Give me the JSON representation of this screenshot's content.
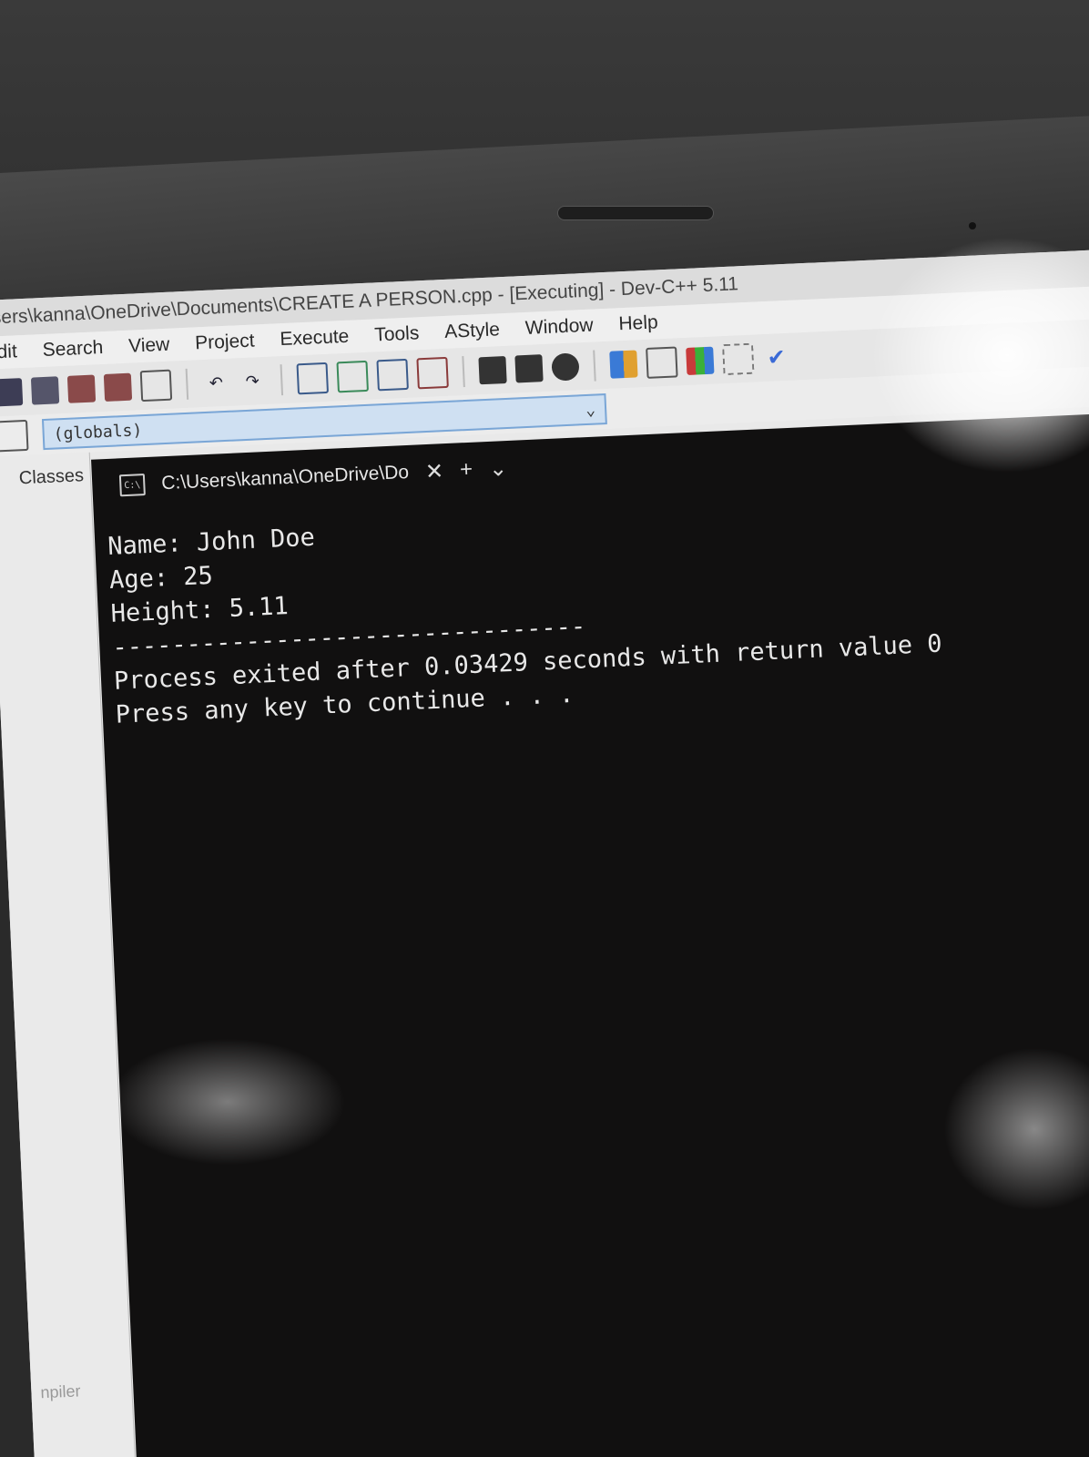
{
  "window": {
    "title": "sers\\kanna\\OneDrive\\Documents\\CREATE A PERSON.cpp - [Executing] - Dev-C++ 5.11"
  },
  "menu": {
    "items": [
      "dit",
      "Search",
      "View",
      "Project",
      "Execute",
      "Tools",
      "AStyle",
      "Window",
      "Help"
    ]
  },
  "scope": {
    "value": "(globals)"
  },
  "side_panel": {
    "tab_label": "Classes",
    "footer_label": "npiler"
  },
  "console": {
    "tab_title": "C:\\Users\\kanna\\OneDrive\\Do",
    "icon_text": "C:\\",
    "close_glyph": "✕",
    "add_glyph": "+",
    "dropdown_glyph": "⌄",
    "lines": [
      "Name: John Doe",
      "Age: 25",
      "Height: 5.11",
      "",
      "--------------------------------",
      "Process exited after 0.03429 seconds with return value 0",
      "Press any key to continue . . ."
    ]
  }
}
